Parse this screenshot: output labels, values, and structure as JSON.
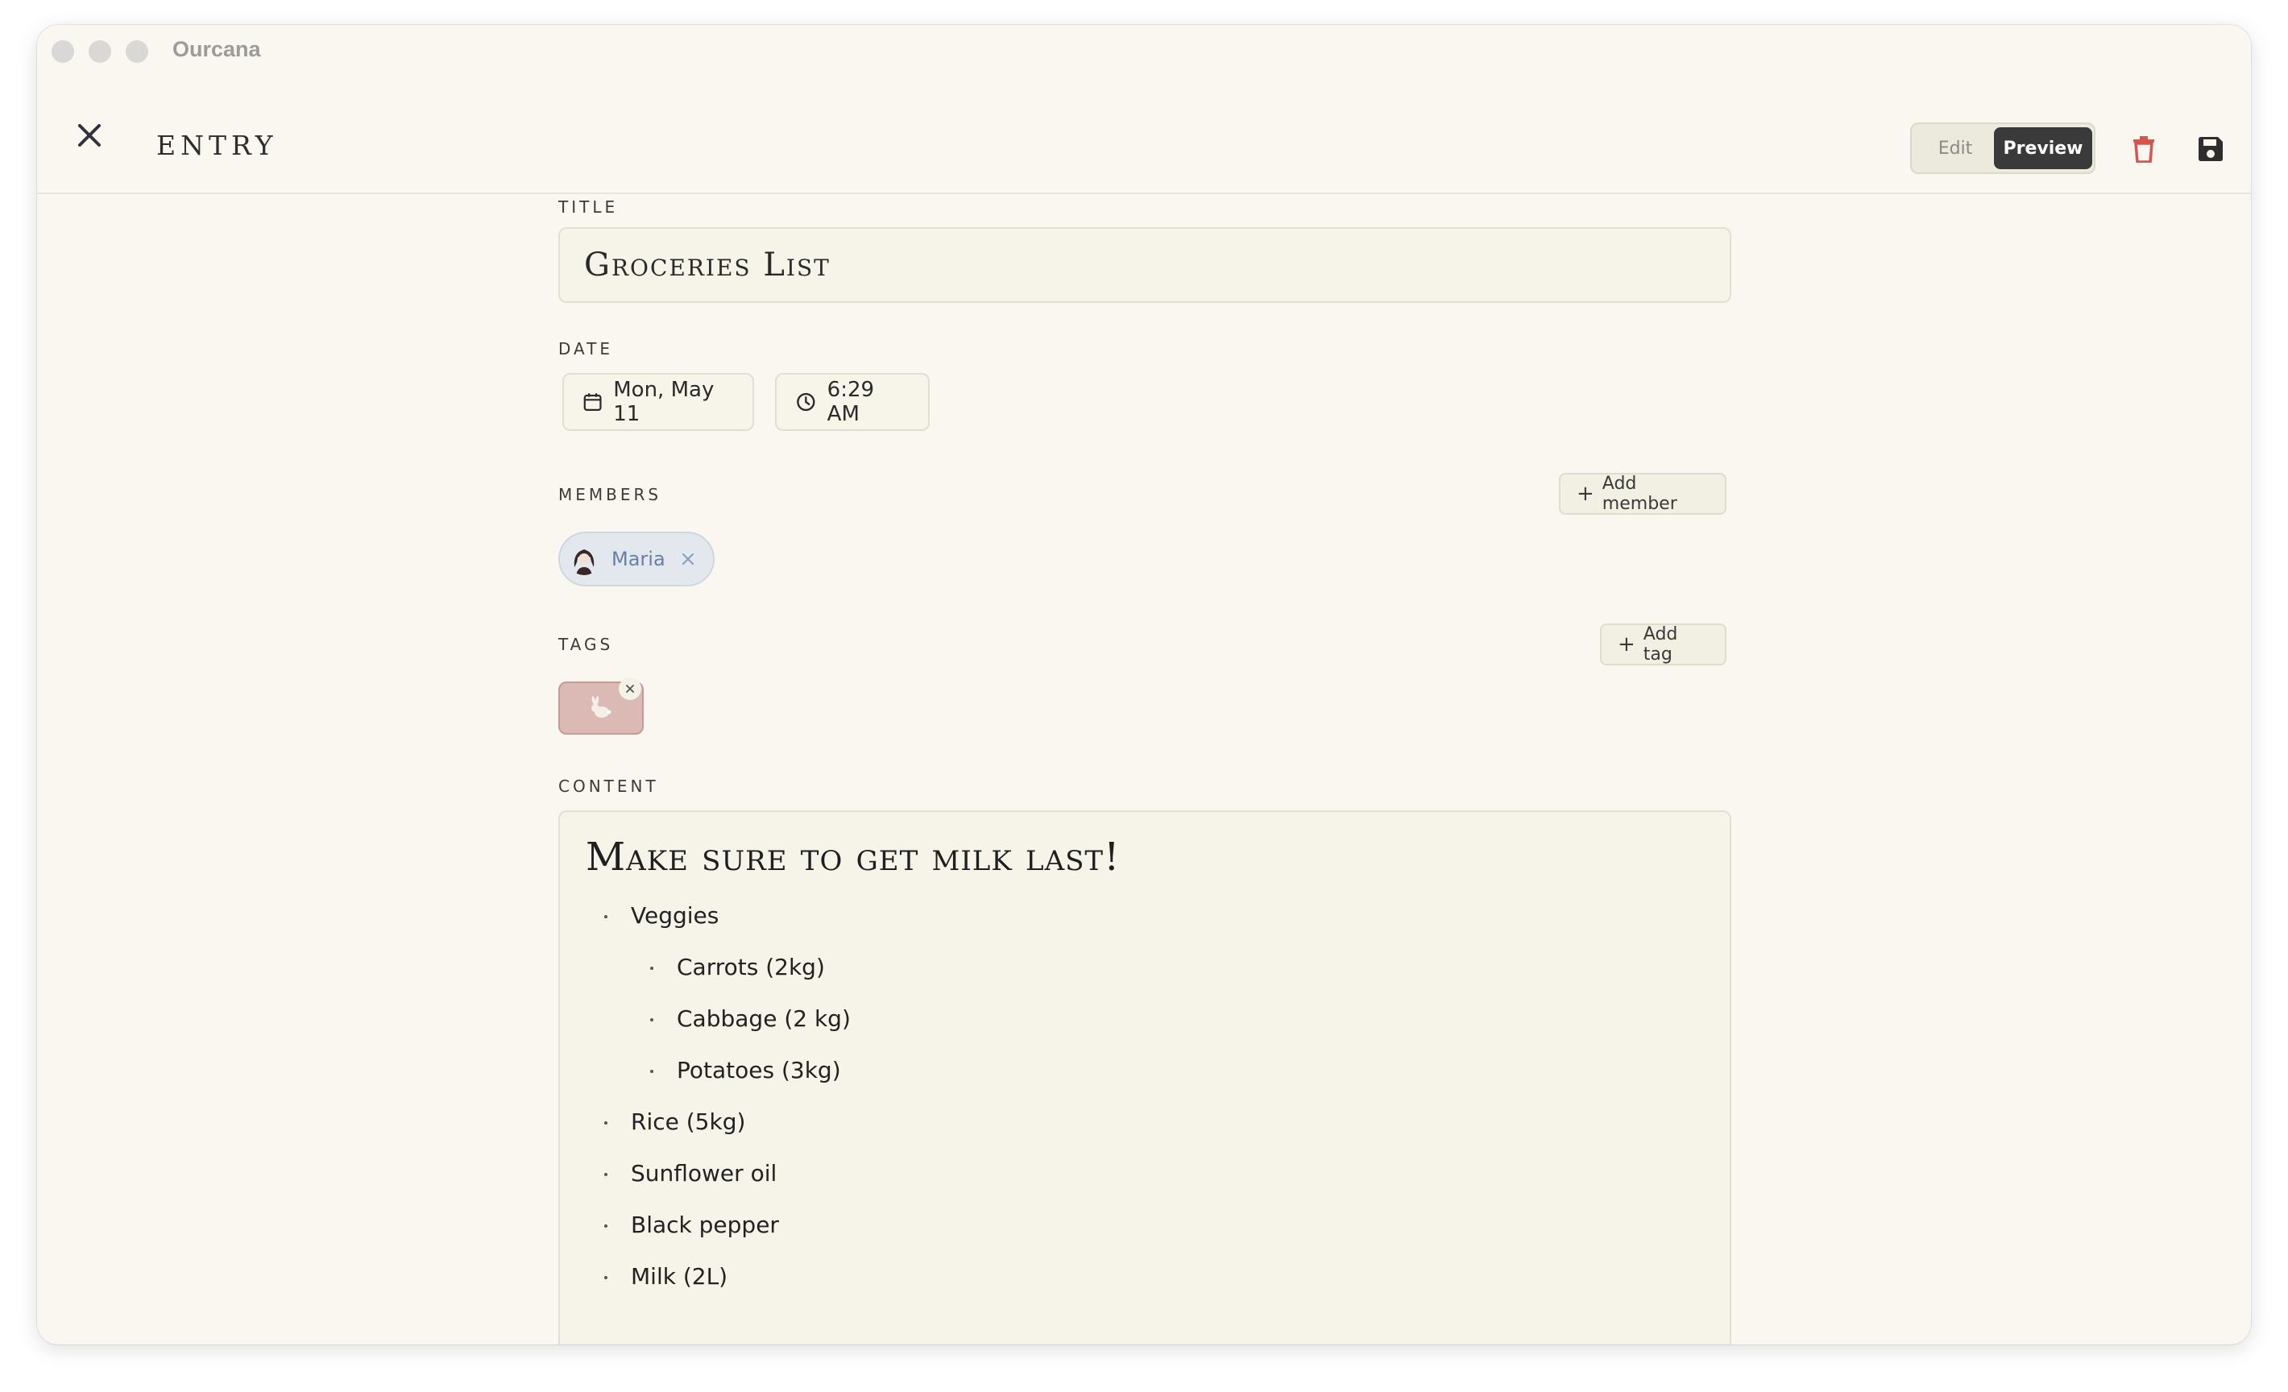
{
  "app": {
    "title": "Ourcana"
  },
  "header": {
    "heading": "ENTRY",
    "mode_edit": "Edit",
    "mode_preview": "Preview",
    "active_mode": "Preview"
  },
  "form": {
    "title_label": "TITLE",
    "title_value": "Groceries List",
    "date_label": "DATE",
    "date_value": "Mon, May 11",
    "time_value": "6:29 AM",
    "members_label": "MEMBERS",
    "add_member_label": "Add member",
    "members": [
      {
        "name": "Maria"
      }
    ],
    "tags_label": "TAGS",
    "add_tag_label": "Add tag",
    "tags": [
      {
        "icon": "rabbit-icon"
      }
    ],
    "content_label": "CONTENT"
  },
  "content": {
    "heading": "Make sure to get milk last!",
    "items": [
      {
        "text": "Veggies",
        "level": 0
      },
      {
        "text": "Carrots (2kg)",
        "level": 1
      },
      {
        "text": "Cabbage (2 kg)",
        "level": 1
      },
      {
        "text": "Potatoes (3kg)",
        "level": 1
      },
      {
        "text": "Rice (5kg)",
        "level": 0
      },
      {
        "text": "Sunflower oil",
        "level": 0
      },
      {
        "text": "Black pepper",
        "level": 0
      },
      {
        "text": "Milk (2L)",
        "level": 0
      }
    ]
  },
  "colors": {
    "background": "#f9f7f0",
    "accent_dark": "#3a3a3a",
    "delete_red": "#d9534f",
    "member_chip": "#e3e8ee",
    "tag_chip": "#dbb9b4"
  }
}
